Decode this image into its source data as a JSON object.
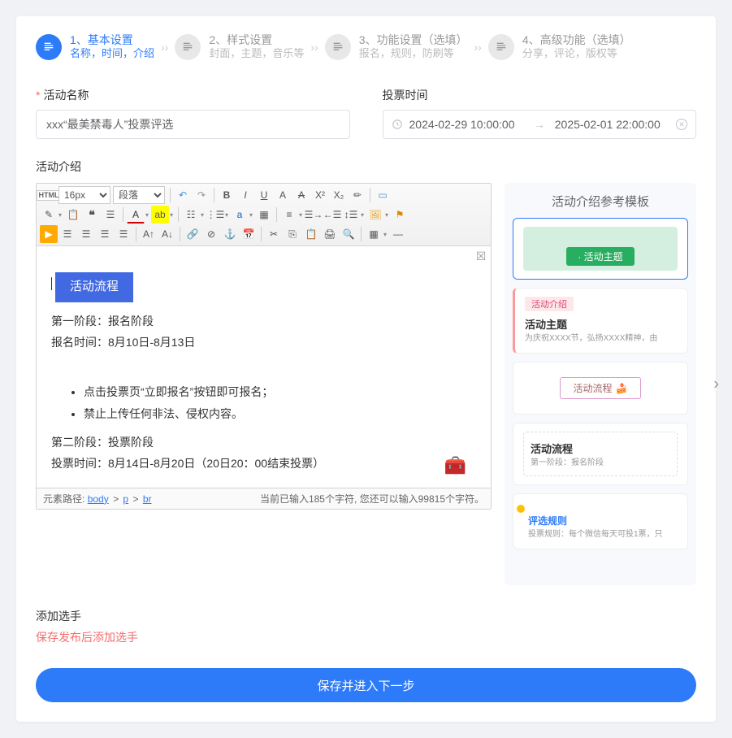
{
  "steps": [
    {
      "title": "1、基本设置",
      "sub": "名称，时间，介绍"
    },
    {
      "title": "2、样式设置",
      "sub": "封面，主题，音乐等"
    },
    {
      "title": "3、功能设置（选填）",
      "sub": "报名，规则，防刷等"
    },
    {
      "title": "4、高级功能（选填）",
      "sub": "分享，评论，版权等"
    }
  ],
  "form": {
    "name_label": "活动名称",
    "name_value": "xxx“最美禁毒人”投票评选",
    "time_label": "投票时间",
    "time_start": "2024-02-29 10:00:00",
    "time_end": "2025-02-01 22:00:00",
    "intro_label": "活动介绍"
  },
  "editor": {
    "font_size": "16px",
    "para": "段落",
    "flow_title": "活动流程",
    "p1": "第一阶段：报名阶段",
    "p2": "报名时间：8月10日-8月13日",
    "li1": "点击投票页“立即报名”按钮即可报名；",
    "li2": "禁止上传任何非法、侵权内容。",
    "p3": "第二阶段：投票阶段",
    "p4": "投票时间：8月14日-8月20日（20日20：00结束投票）",
    "path_label": "元素路径:",
    "path_body": "body",
    "path_p": "p",
    "path_br": "br",
    "char_count": "当前已输入185个字符, 您还可以输入99815个字符。"
  },
  "templates": {
    "title": "活动介绍参考模板",
    "t1_badge": "· 活动主题",
    "t2_pink": "活动介绍",
    "t2_h": "活动主题",
    "t2_p": "为庆祝XXXX节，弘扬XXXX精神，由",
    "t3_badge": "活动流程",
    "t4_h": "活动流程",
    "t4_p": "第一阶段：报名阶段",
    "t5_h": "评选规则",
    "t5_p": "投票规则：每个微信每天可投1票，只"
  },
  "add": {
    "label": "添加选手",
    "note": "保存发布后添加选手"
  },
  "footer": {
    "save_next": "保存并进入下一步"
  }
}
